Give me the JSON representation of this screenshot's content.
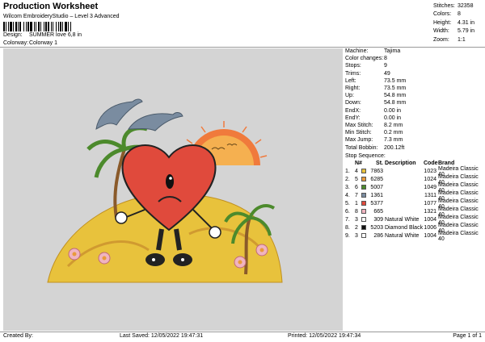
{
  "header": {
    "title": "Production Worksheet",
    "software": "Wilcom EmbroideryStudio – Level 3 Advanced",
    "design_label": "Design:",
    "design_value": "SUMMER love 6,8 in",
    "colorway_label": "Colorway:",
    "colorway_value": "Colorway 1"
  },
  "stats": [
    {
      "k": "Stitches:",
      "v": "32358"
    },
    {
      "k": "Colors:",
      "v": "8"
    },
    {
      "k": "Height:",
      "v": "4.31 in"
    },
    {
      "k": "Width:",
      "v": "5.79 in"
    },
    {
      "k": "Zoom:",
      "v": "1:1"
    }
  ],
  "info": [
    {
      "k": "Machine:",
      "v": "Tajima"
    },
    {
      "k": "Color changes:",
      "v": "8"
    },
    {
      "k": "Stops:",
      "v": "9"
    },
    {
      "k": "Trims:",
      "v": "49"
    },
    {
      "k": "Left:",
      "v": "73.5 mm"
    },
    {
      "k": "Right:",
      "v": "73.5 mm"
    },
    {
      "k": "Up:",
      "v": "54.8 mm"
    },
    {
      "k": "Down:",
      "v": "54.8 mm"
    },
    {
      "k": "EndX:",
      "v": "0.00 in"
    },
    {
      "k": "EndY:",
      "v": "0.00 in"
    },
    {
      "k": "Max Stitch:",
      "v": "8.2 mm"
    },
    {
      "k": "Min Stitch:",
      "v": "0.2 mm"
    },
    {
      "k": "Max Jump:",
      "v": "7.3 mm"
    },
    {
      "k": "Total Bobbin:",
      "v": "200.12ft"
    }
  ],
  "sequence": {
    "label": "Stop Sequence:",
    "headers": {
      "n": "N#",
      "st": "St.",
      "desc": "Description",
      "code": "Code",
      "brand": "Brand"
    },
    "rows": [
      {
        "idx": "1.",
        "n": "4",
        "color": "#e8c23c",
        "st": "7863",
        "desc": "",
        "code": "1023",
        "brand": "Madeira Classic 40"
      },
      {
        "idx": "2.",
        "n": "5",
        "color": "#e89a3c",
        "st": "6285",
        "desc": "",
        "code": "1024",
        "brand": "Madeira Classic 40"
      },
      {
        "idx": "3.",
        "n": "6",
        "color": "#4c8a2c",
        "st": "5007",
        "desc": "",
        "code": "1049",
        "brand": "Madeira Classic 40"
      },
      {
        "idx": "4.",
        "n": "7",
        "color": "#7a8ca0",
        "st": "1361",
        "desc": "",
        "code": "1311",
        "brand": "Madeira Classic 40"
      },
      {
        "idx": "5.",
        "n": "1",
        "color": "#e04a3c",
        "st": "5377",
        "desc": "",
        "code": "1077",
        "brand": "Madeira Classic 40"
      },
      {
        "idx": "6.",
        "n": "8",
        "color": "#f0b4c0",
        "st": "665",
        "desc": "",
        "code": "1321",
        "brand": "Madeira Classic 40"
      },
      {
        "idx": "7.",
        "n": "3",
        "color": "#ffffff",
        "st": "309",
        "desc": "Natural White",
        "code": "1004",
        "brand": "Madeira Classic 40"
      },
      {
        "idx": "8.",
        "n": "2",
        "color": "#111111",
        "st": "5203",
        "desc": "Diamond Black",
        "code": "1006",
        "brand": "Madeira Classic 40"
      },
      {
        "idx": "9.",
        "n": "3",
        "color": "#ffffff",
        "st": "286",
        "desc": "Natural White",
        "code": "1004",
        "brand": "Madeira Classic 40"
      }
    ]
  },
  "footer": {
    "created": "Created By:",
    "saved": "Last Saved: 12/05/2022 19:47:31",
    "printed": "Printed: 12/05/2022 19:47:34",
    "page": "Page 1 of 1"
  },
  "colors": {
    "canvas_bg": "#d4d4d4",
    "heart": "#e04a3c",
    "sand": "#e8c23c",
    "sun": "#f07a3c",
    "palm": "#4c8a2c",
    "dolphin": "#7a8ca0"
  }
}
